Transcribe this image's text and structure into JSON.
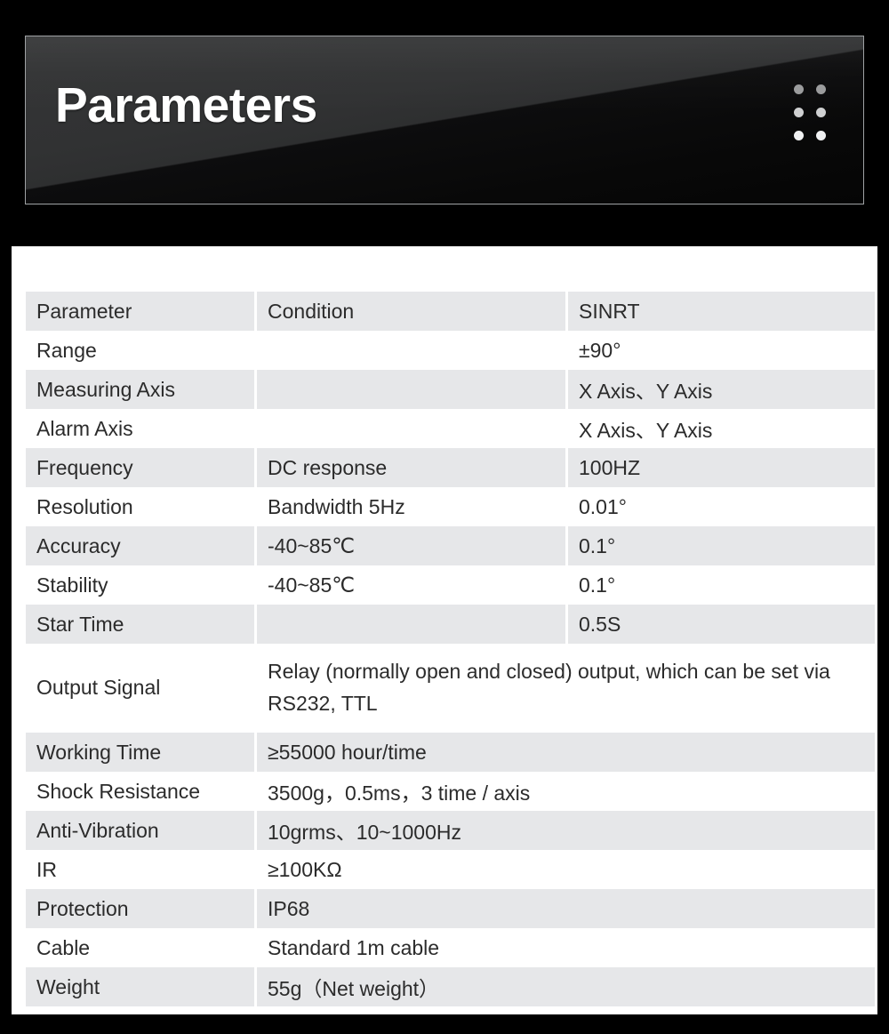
{
  "banner": {
    "title": "Parameters",
    "dots_icon": "dot-grid-icon",
    "dot_count": 6
  },
  "table": {
    "headers": [
      "Parameter",
      "Condition",
      "SINRT"
    ],
    "rows": [
      {
        "parameter": "Range",
        "condition": "",
        "value": "±90°",
        "span": false,
        "shaded": false
      },
      {
        "parameter": "Measuring Axis",
        "condition": "",
        "value": "X Axis、Y Axis",
        "span": false,
        "shaded": true
      },
      {
        "parameter": "Alarm Axis",
        "condition": "",
        "value": "X Axis、Y Axis",
        "span": false,
        "shaded": false
      },
      {
        "parameter": "Frequency",
        "condition": "DC response",
        "value": "100HZ",
        "span": false,
        "shaded": true
      },
      {
        "parameter": "Resolution",
        "condition": "Bandwidth 5Hz",
        "value": "0.01°",
        "span": false,
        "shaded": false
      },
      {
        "parameter": "Accuracy",
        "condition": "-40~85℃",
        "value": "0.1°",
        "span": false,
        "shaded": true
      },
      {
        "parameter": "Stability",
        "condition": "-40~85℃",
        "value": "0.1°",
        "span": false,
        "shaded": false
      },
      {
        "parameter": "Star Time",
        "condition": "",
        "value": "0.5S",
        "span": false,
        "shaded": true
      },
      {
        "parameter": "Output Signal",
        "condition": "Relay (normally open and closed) output, which can be set via RS232, TTL",
        "value": "",
        "span": true,
        "shaded": false,
        "tall": true
      },
      {
        "parameter": "Working Time",
        "condition": "≥55000 hour/time",
        "value": "",
        "span": true,
        "shaded": true
      },
      {
        "parameter": "Shock Resistance",
        "condition": "3500g，0.5ms，3 time / axis",
        "value": "",
        "span": true,
        "shaded": false
      },
      {
        "parameter": "Anti-Vibration",
        "condition": "10grms、10~1000Hz",
        "value": "",
        "span": true,
        "shaded": true
      },
      {
        "parameter": "IR",
        "condition": "≥100KΩ",
        "value": "",
        "span": true,
        "shaded": false
      },
      {
        "parameter": "Protection",
        "condition": "IP68",
        "value": "",
        "span": true,
        "shaded": true
      },
      {
        "parameter": "Cable",
        "condition": "Standard 1m cable",
        "value": "",
        "span": true,
        "shaded": false
      },
      {
        "parameter": "Weight",
        "condition": "55g（Net weight）",
        "value": "",
        "span": true,
        "shaded": true
      }
    ]
  },
  "colors": {
    "page_background": "#000000",
    "panel_background": "#ffffff",
    "row_shade": "#e6e7e9",
    "text": "#2b2b2b",
    "banner_title": "#ffffff",
    "banner_border": "#9fa2a4",
    "dot": "#d8d9da"
  }
}
